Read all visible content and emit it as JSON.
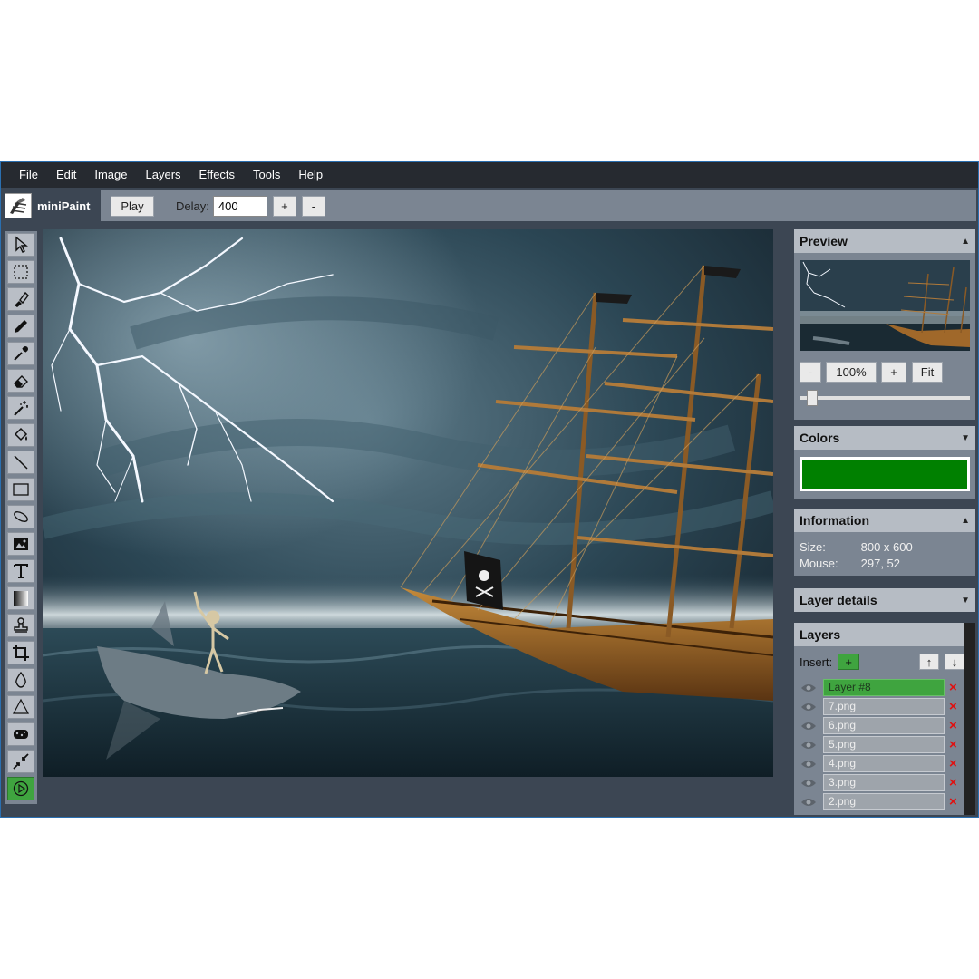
{
  "menu": [
    "File",
    "Edit",
    "Image",
    "Layers",
    "Effects",
    "Tools",
    "Help"
  ],
  "app": {
    "name": "miniPaint"
  },
  "attributes": {
    "play_label": "Play",
    "delay_label": "Delay:",
    "delay_value": "400",
    "plus_label": "+",
    "minus_label": "-"
  },
  "tools": [
    {
      "name": "select",
      "icon": "cursor-icon"
    },
    {
      "name": "selection",
      "icon": "dashed-rect-icon"
    },
    {
      "name": "brush",
      "icon": "brush-icon"
    },
    {
      "name": "pencil",
      "icon": "pencil-icon"
    },
    {
      "name": "pick-color",
      "icon": "eyedropper-icon"
    },
    {
      "name": "erase",
      "icon": "eraser-icon"
    },
    {
      "name": "magic-wand",
      "icon": "magic-wand-icon"
    },
    {
      "name": "fill",
      "icon": "bucket-icon"
    },
    {
      "name": "line",
      "icon": "line-icon"
    },
    {
      "name": "rectangle",
      "icon": "rectangle-icon"
    },
    {
      "name": "ellipse",
      "icon": "ellipse-icon"
    },
    {
      "name": "media",
      "icon": "image-icon"
    },
    {
      "name": "text",
      "icon": "text-icon"
    },
    {
      "name": "gradient",
      "icon": "gradient-icon"
    },
    {
      "name": "clone",
      "icon": "stamp-icon"
    },
    {
      "name": "crop",
      "icon": "crop-icon"
    },
    {
      "name": "blur",
      "icon": "drop-icon"
    },
    {
      "name": "sharpen",
      "icon": "triangle-icon"
    },
    {
      "name": "desaturate",
      "icon": "sponge-icon"
    },
    {
      "name": "bulge-pinch",
      "icon": "pinch-icon"
    },
    {
      "name": "animation",
      "icon": "play-circle-icon",
      "active": true
    }
  ],
  "preview": {
    "title": "Preview",
    "zoom_minus": "-",
    "zoom_value": "100%",
    "zoom_plus": "+",
    "zoom_fit": "Fit"
  },
  "colors": {
    "title": "Colors",
    "active_color": "#008000"
  },
  "information": {
    "title": "Information",
    "size_label": "Size:",
    "size_value": "800 x 600",
    "mouse_label": "Mouse:",
    "mouse_value": "297, 52"
  },
  "layer_details": {
    "title": "Layer details"
  },
  "layers": {
    "title": "Layers",
    "insert_label": "Insert:",
    "insert_btn": "+",
    "up_btn": "↑",
    "down_btn": "↓",
    "items": [
      {
        "name": "Layer #8",
        "active": true
      },
      {
        "name": "7.png"
      },
      {
        "name": "6.png"
      },
      {
        "name": "5.png"
      },
      {
        "name": "4.png"
      },
      {
        "name": "3.png"
      },
      {
        "name": "2.png"
      }
    ],
    "delete_glyph": "×"
  }
}
